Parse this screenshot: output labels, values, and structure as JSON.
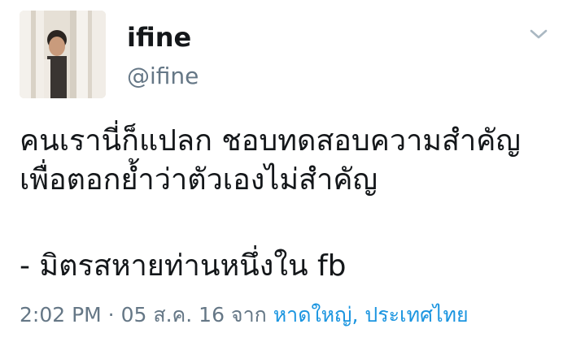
{
  "user": {
    "display_name": "ifine",
    "handle": "@ifine"
  },
  "icons": {
    "avatar": "profile-photo",
    "menu": "chevron-down-icon"
  },
  "tweet": {
    "lines": [
      "คนเรานี่ก็แปลก ชอบทดสอบความสำคัญ",
      "เพื่อตอกย้ำว่าตัวเองไม่สำคัญ",
      "- มิตรสหายท่านหนึ่งใน fb"
    ]
  },
  "meta": {
    "time": "2:02 PM",
    "separator": " · ",
    "date": "05 ส.ค. 16",
    "from_label": " จาก ",
    "location": "หาดใหญ่, ประเทศไทย"
  },
  "colors": {
    "text": "#14171a",
    "secondary": "#657786",
    "link": "#1b95e0"
  }
}
